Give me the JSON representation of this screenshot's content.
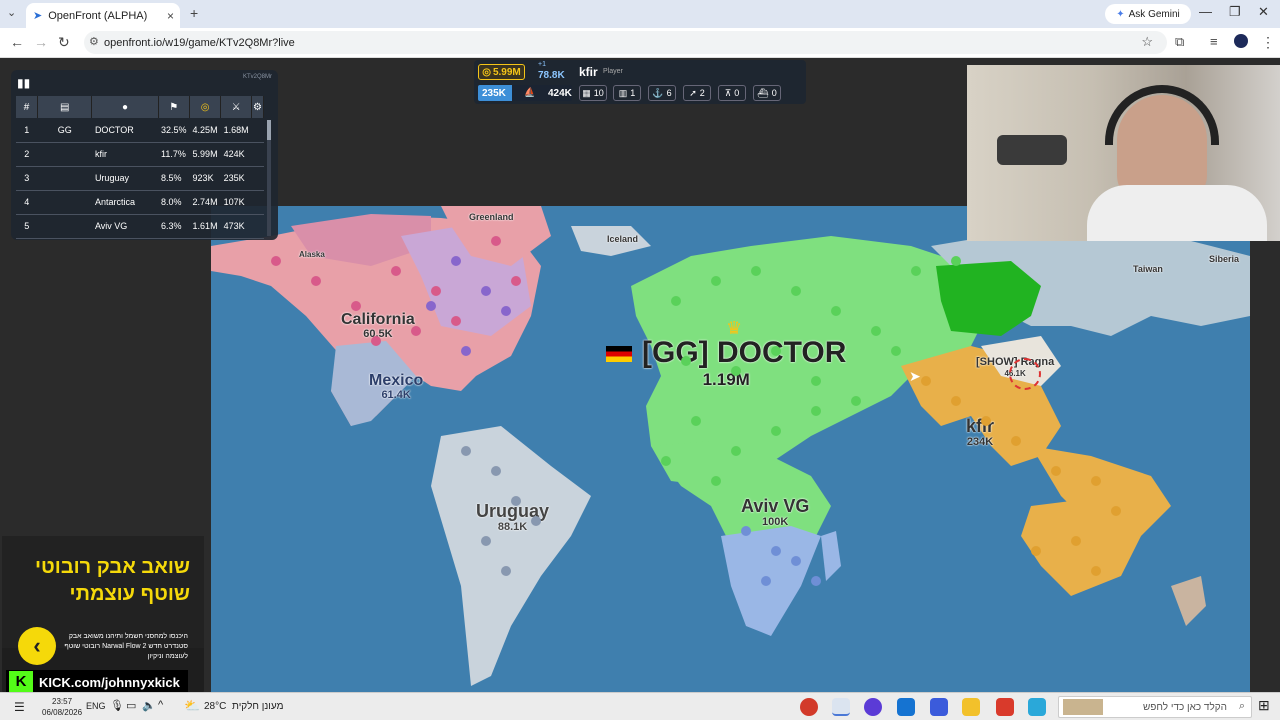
{
  "browser": {
    "tab_title": "OpenFront (ALPHA)",
    "url": "openfront.io/w19/game/KTv2Q8Mr?live",
    "gemini_label": "Ask Gemini",
    "new_tab": "+",
    "close_tab": "×"
  },
  "leaderboard": {
    "game_id": "KTv2Q8Mr",
    "headers": [
      "#",
      "",
      "",
      "",
      "",
      "",
      ""
    ],
    "rows": [
      {
        "rank": "1",
        "clan": "GG",
        "name": "DOCTOR",
        "pct": "32.5%",
        "gold": "4.25M",
        "troops": "1.68M"
      },
      {
        "rank": "2",
        "clan": "",
        "name": "kfir",
        "pct": "11.7%",
        "gold": "5.99M",
        "troops": "424K"
      },
      {
        "rank": "3",
        "clan": "",
        "name": "Uruguay",
        "pct": "8.5%",
        "gold": "923K",
        "troops": "235K"
      },
      {
        "rank": "4",
        "clan": "",
        "name": "Antarctica",
        "pct": "8.0%",
        "gold": "2.74M",
        "troops": "107K"
      },
      {
        "rank": "5",
        "clan": "",
        "name": "Aviv VG",
        "pct": "6.3%",
        "gold": "1.61M",
        "troops": "473K"
      }
    ]
  },
  "hud": {
    "gold": "5.99M",
    "troop_rate": "+1",
    "troops_top": "78.8K",
    "player_name": "kfir",
    "player_tag": "Player",
    "attack_troops": "235K",
    "defense_troops": "424K",
    "attack_ratio": 0.36,
    "counts": [
      {
        "icon": "city-icon",
        "value": "10"
      },
      {
        "icon": "factory-icon",
        "value": "1"
      },
      {
        "icon": "port-icon",
        "value": "6"
      },
      {
        "icon": "missile-silo-icon",
        "value": "2"
      },
      {
        "icon": "sam-icon",
        "value": "0"
      },
      {
        "icon": "warship-icon",
        "value": "0"
      }
    ]
  },
  "map": {
    "players": [
      {
        "name": "[GG] DOCTOR",
        "troops": "1.19M",
        "color": "#7fe07f"
      },
      {
        "name": "kfir",
        "troops": "234K",
        "color": "#e8b04a"
      },
      {
        "name": "[SHOW] Ragna",
        "troops": "46.1K",
        "color": "#e8e4dc"
      },
      {
        "name": "Aviv VG",
        "troops": "100K",
        "color": "#9ab7e6"
      },
      {
        "name": "Uruguay",
        "troops": "88.1K",
        "color": "#c9d3dc"
      },
      {
        "name": "California",
        "troops": "60.5K",
        "color": "#e89aa4"
      },
      {
        "name": "Mexico",
        "troops": "61.4K",
        "color": "#a9b9d6"
      }
    ],
    "small_labels": [
      "Greenland",
      "Iceland",
      "Alaska",
      "Taiwan",
      "Siberia"
    ]
  },
  "ad": {
    "headline_1": "שואב אבק רובוטי",
    "headline_2": "שוטף עוצמתי",
    "body": "היכנסו למחסני חשמל ותיהנו משואב אבק רובוטי שוטף Narwal Flow 2 סטנדרט חדש לעוצמה וניקיון",
    "kick_handle": "KICK.com/johnnyxkick"
  },
  "taskbar": {
    "time": "23:57",
    "date": "06/08/2026",
    "lang": "ENG",
    "weather_temp": "28°C",
    "weather_desc": "מעונן חלקית",
    "search_placeholder": "הקלד כאן כדי לחפש"
  }
}
